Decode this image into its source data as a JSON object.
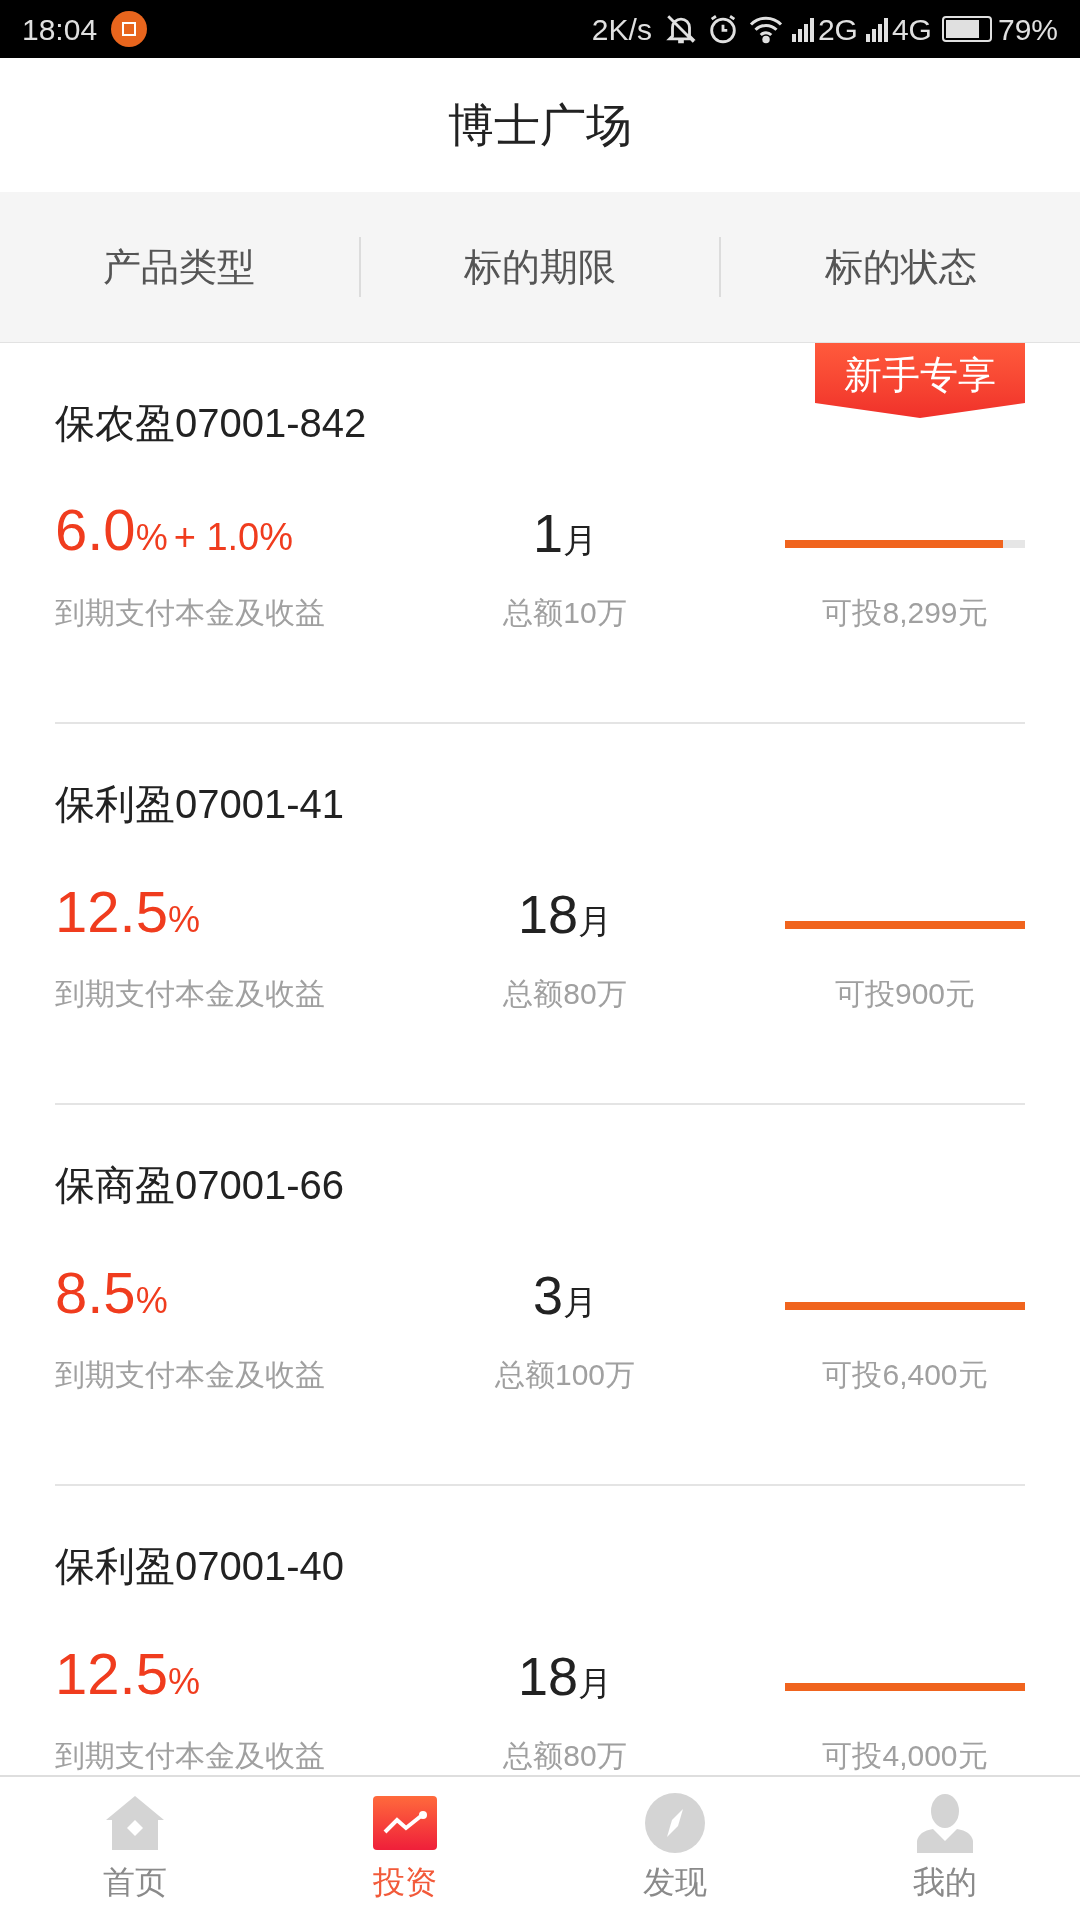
{
  "status_bar": {
    "time": "18:04",
    "speed": "2K/s",
    "net_1": "2G",
    "net_2": "4G",
    "battery": "79%"
  },
  "header": {
    "title": "博士广场"
  },
  "filters": [
    {
      "label": "产品类型"
    },
    {
      "label": "标的期限"
    },
    {
      "label": "标的状态"
    }
  ],
  "products": [
    {
      "name": "保农盈07001-842",
      "badge": "新手专享",
      "rate": "6.0",
      "rate_unit": "%",
      "bonus": "+ 1.0%",
      "rate_note": "到期支付本金及收益",
      "term": "1",
      "term_unit": "月",
      "total": "总额10万",
      "level": 0.91,
      "available": "可投8,299元"
    },
    {
      "name": "保利盈07001-41",
      "rate": "12.5",
      "rate_unit": "%",
      "rate_note": "到期支付本金及收益",
      "term": "18",
      "term_unit": "月",
      "total": "总额80万",
      "level": 1,
      "available": "可投900元"
    },
    {
      "name": "保商盈07001-66",
      "rate": "8.5",
      "rate_unit": "%",
      "rate_note": "到期支付本金及收益",
      "term": "3",
      "term_unit": "月",
      "total": "总额100万",
      "level": 1,
      "available": "可投6,400元"
    },
    {
      "name": "保利盈07001-40",
      "rate": "12.5",
      "rate_unit": "%",
      "rate_note": "到期支付本金及收益",
      "term": "18",
      "term_unit": "月",
      "total": "总额80万",
      "level": 1,
      "available": "可投4,000元"
    }
  ],
  "tab_bar": [
    {
      "label": "首页",
      "kind": "home",
      "selected": false
    },
    {
      "label": "投资",
      "kind": "invest",
      "selected": true
    },
    {
      "label": "发现",
      "kind": "discover",
      "selected": false
    },
    {
      "label": "我的",
      "kind": "me",
      "selected": false
    }
  ]
}
